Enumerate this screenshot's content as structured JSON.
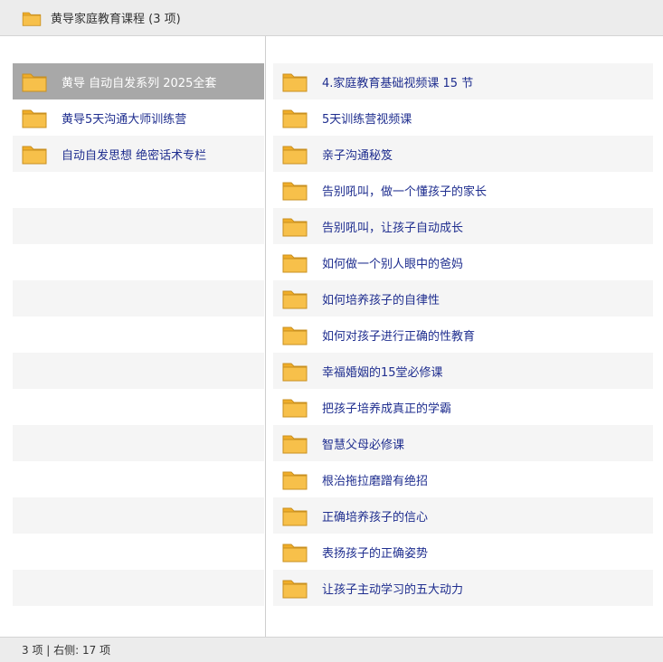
{
  "window": {
    "title": "黄导家庭教育课程 (3 项)"
  },
  "colors": {
    "folder_fill": "#f7c04a",
    "folder_tab": "#f0ad28",
    "folder_edge": "#c99020",
    "label_text": "#1f2e8f",
    "selected_bg": "#a8a8a8",
    "alt_row_bg": "#f5f5f5"
  },
  "icons": {
    "folder": "folder-icon"
  },
  "left_pane": {
    "selected_index": 0,
    "items": [
      {
        "label": "黄导 自动自发系列 2025全套"
      },
      {
        "label": "黄导5天沟通大师训练营"
      },
      {
        "label": "自动自发思想  绝密话术专栏"
      }
    ]
  },
  "right_pane": {
    "items": [
      {
        "label": "4.家庭教育基础视频课 15 节"
      },
      {
        "label": "5天训练营视频课"
      },
      {
        "label": "亲子沟通秘笈"
      },
      {
        "label": "告别吼叫，做一个懂孩子的家长"
      },
      {
        "label": "告别吼叫，让孩子自动成长"
      },
      {
        "label": "如何做一个别人眼中的爸妈"
      },
      {
        "label": "如何培养孩子的自律性"
      },
      {
        "label": "如何对孩子进行正确的性教育"
      },
      {
        "label": "幸福婚姻的15堂必修课"
      },
      {
        "label": "把孩子培养成真正的学霸"
      },
      {
        "label": "智慧父母必修课"
      },
      {
        "label": "根治拖拉磨蹭有绝招"
      },
      {
        "label": "正确培养孩子的信心"
      },
      {
        "label": "表扬孩子的正确姿势"
      },
      {
        "label": "让孩子主动学习的五大动力"
      }
    ]
  },
  "status": {
    "text": "3 项 | 右侧: 17 项"
  }
}
